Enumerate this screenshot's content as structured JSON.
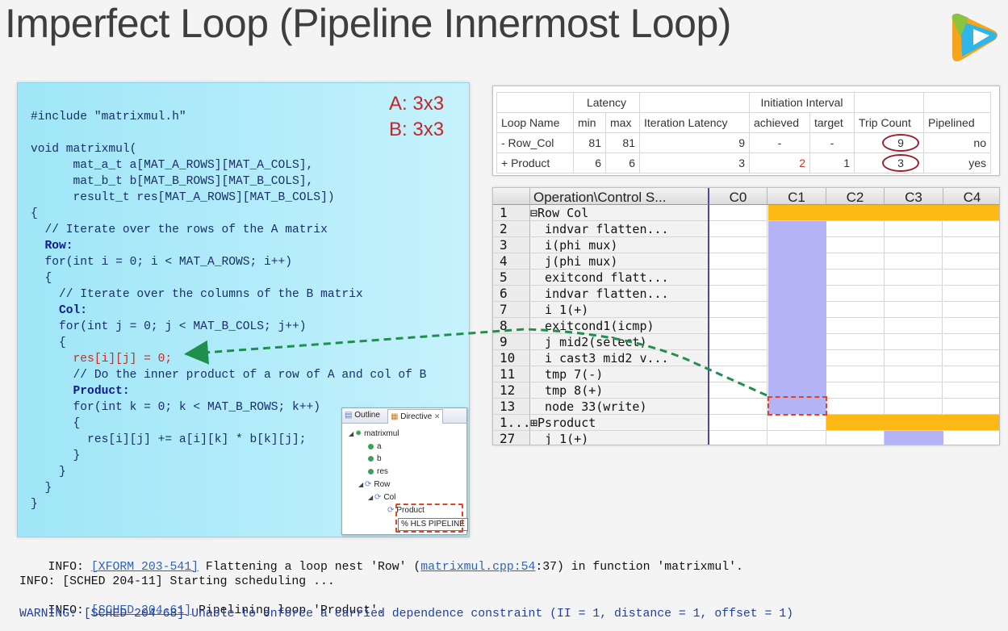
{
  "slide": {
    "title": "Imperfect Loop (Pipeline Innermost Loop)"
  },
  "logo": {
    "icon": "play-logo-icon",
    "colors": [
      "#f7a41d",
      "#2fb6e8",
      "#8bc53f"
    ]
  },
  "code": {
    "dims": [
      "A: 3x3",
      "B: 3x3"
    ],
    "lines": [
      "#include \"matrixmul.h\"",
      "void matrixmul(",
      "      mat_a_t a[MAT_A_ROWS][MAT_A_COLS],",
      "      mat_b_t b[MAT_B_ROWS][MAT_B_COLS],",
      "      result_t res[MAT_A_ROWS][MAT_B_COLS])",
      "{",
      "  // Iterate over the rows of the A matrix",
      "  Row:",
      "  for(int i = 0; i < MAT_A_ROWS; i++)",
      "  {",
      "    // Iterate over the columns of the B matrix",
      "    Col:",
      "    for(int j = 0; j < MAT_B_COLS; j++)",
      "    {",
      "      res[i][j] = 0;",
      "      // Do the inner product of a row of A and col of B",
      "      Product:",
      "      for(int k = 0; k < MAT_B_ROWS; k++)",
      "      {",
      "        res[i][j] += a[i][k] * b[k][j];",
      "      }",
      "    }",
      "  }",
      "}"
    ]
  },
  "outline": {
    "tabs": [
      "Outline",
      "Directive"
    ],
    "items": [
      "matrixmul",
      "a",
      "b",
      "res",
      "Row",
      "Col",
      "Product",
      "% HLS PIPELINE"
    ]
  },
  "latency_table": {
    "group_headers": [
      "Latency",
      "Initiation Interval"
    ],
    "headers": [
      "Loop Name",
      "min",
      "max",
      "Iteration Latency",
      "achieved",
      "target",
      "Trip Count",
      "Pipelined"
    ],
    "rows": [
      [
        "- Row_Col",
        "81",
        "81",
        "9",
        "-",
        "-",
        "9",
        "no"
      ],
      [
        "+ Product",
        "6",
        "6",
        "3",
        "2",
        "1",
        "3",
        "yes"
      ]
    ]
  },
  "schedule": {
    "header_op": "Operation\\Control S...",
    "columns": [
      "C0",
      "C1",
      "C2",
      "C3",
      "C4"
    ],
    "rows": [
      {
        "num": "1",
        "op": "⊟Row Col"
      },
      {
        "num": "2",
        "op": "  indvar flatten..."
      },
      {
        "num": "3",
        "op": "  i(phi mux)"
      },
      {
        "num": "4",
        "op": "  j(phi mux)"
      },
      {
        "num": "5",
        "op": "  exitcond flatt..."
      },
      {
        "num": "6",
        "op": "  indvar flatten..."
      },
      {
        "num": "7",
        "op": "  i 1(+)"
      },
      {
        "num": "8",
        "op": "  exitcond1(icmp)"
      },
      {
        "num": "9",
        "op": "  j mid2(select)"
      },
      {
        "num": "10",
        "op": "  i cast3 mid2 v..."
      },
      {
        "num": "11",
        "op": "  tmp 7(-)"
      },
      {
        "num": "12",
        "op": "  tmp 8(+)"
      },
      {
        "num": "13",
        "op": "  node 33(write)"
      },
      {
        "num": "1...",
        "op": "⊞Psroduct"
      },
      {
        "num": "27",
        "op": "  j 1(+)"
      }
    ],
    "colors": {
      "orange": "#fdb813",
      "lavender": "#b3b3f5"
    }
  },
  "log": {
    "line1_prefix": "INFO: ",
    "line1_link": "[XFORM 203-541]",
    "line1_text": " Flattening a loop nest 'Row' (",
    "line1_link2": "matrixmul.cpp:54",
    "line1_suffix": ":37) in function 'matrixmul'.",
    "line2": "INFO: [SCHED 204-11] Starting scheduling ...",
    "line3_prefix": "INFO: ",
    "line3_link": "[SCHED 204-61]",
    "line3_suffix": " Pipelining loop 'Product'.",
    "line4": "WARNING: [SCHED 204-68] Unable to enforce a carried dependence constraint (II = 1, distance = 1, offset = 1)"
  }
}
